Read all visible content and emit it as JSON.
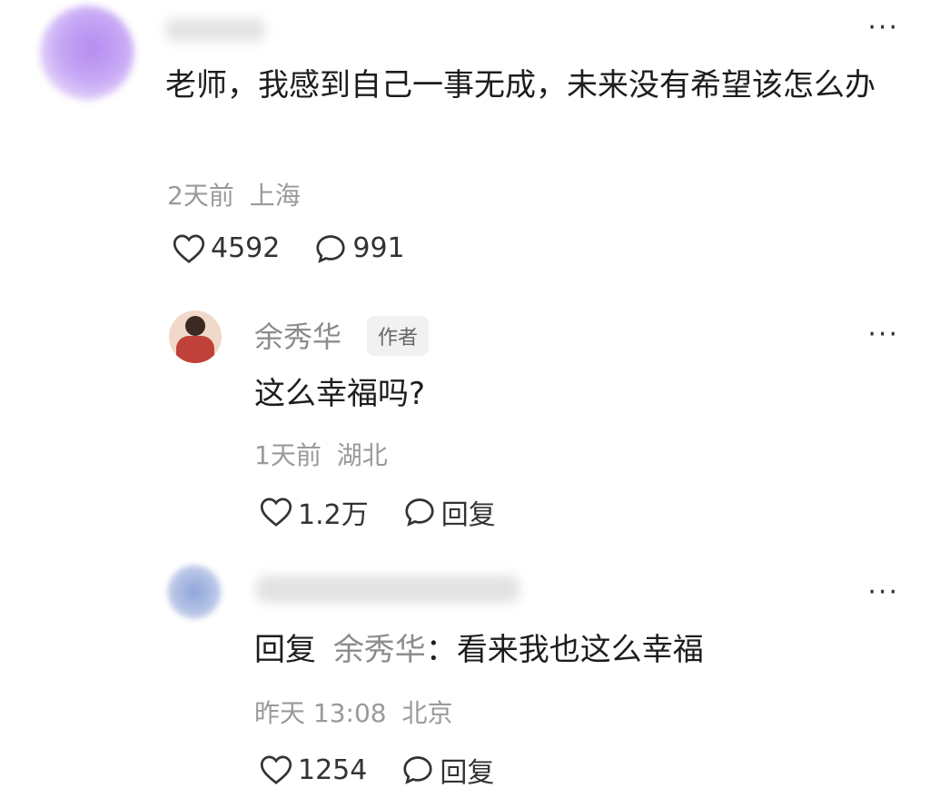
{
  "comment_main": {
    "username_hidden": true,
    "content": "老师，我感到自己一事无成，未来没有希望该怎么办",
    "time": "2天前",
    "location": "上海",
    "likes": "4592",
    "replies": "991",
    "more_label": "···"
  },
  "reply_author": {
    "username": "余秀华",
    "badge": "作者",
    "content": "这么幸福吗?",
    "time": "1天前",
    "location": "湖北",
    "likes": "1.2万",
    "reply_label": "回复",
    "more_label": "···"
  },
  "reply_user": {
    "username_hidden": true,
    "reply_prefix": "回复",
    "reply_target": "余秀华",
    "separator": "：",
    "content": "看来我也这么幸福",
    "time": "昨天 13:08",
    "location": "北京",
    "likes": "1254",
    "reply_label": "回复",
    "more_label": "···"
  },
  "colors": {
    "meta": "#9a9a9a",
    "username": "#8c8c8c",
    "badge_bg": "#f1f1f1"
  }
}
